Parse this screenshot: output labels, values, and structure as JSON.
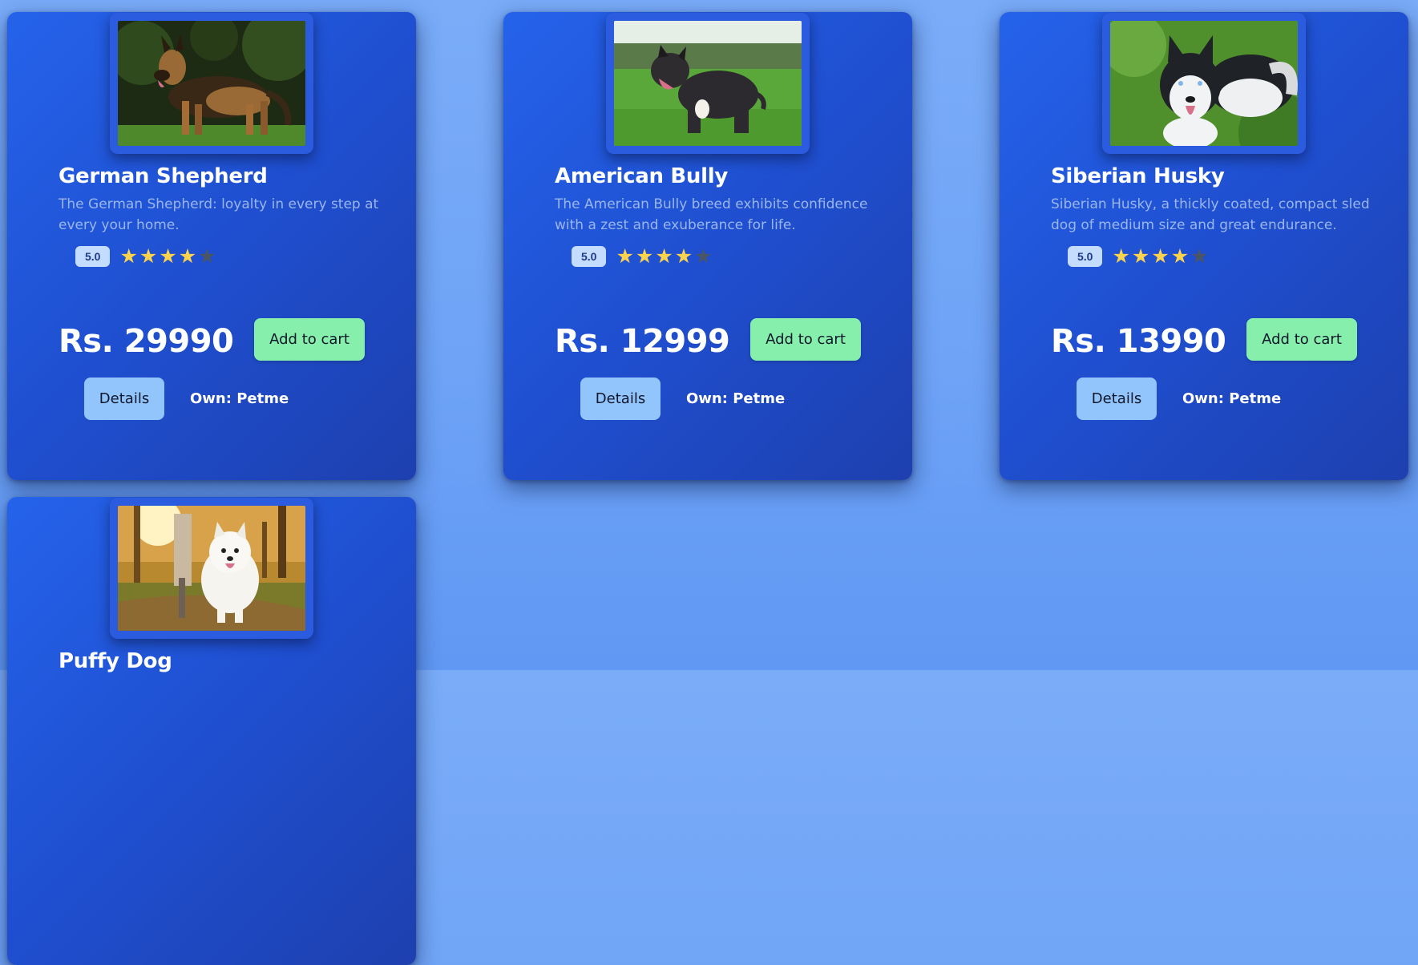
{
  "products": [
    {
      "name": "German Shepherd",
      "description": "The German Shepherd: loyalty in every step at every your home.",
      "rating": "5.0",
      "stars_filled": 4,
      "stars_total": 5,
      "price": "Rs. 29990",
      "cart_label": "Add to cart",
      "details_label": "Details",
      "owner": "Own: Petme",
      "image_icon": "german-shepherd-photo"
    },
    {
      "name": "American Bully",
      "description": "The American Bully breed exhibits confidence with a zest and exuberance for life.",
      "rating": "5.0",
      "stars_filled": 4,
      "stars_total": 5,
      "price": "Rs. 12999",
      "cart_label": "Add to cart",
      "details_label": "Details",
      "owner": "Own: Petme",
      "image_icon": "american-bully-photo"
    },
    {
      "name": "Siberian Husky",
      "description": "Siberian Husky, a thickly coated, compact sled dog of medium size and great endurance.",
      "rating": "5.0",
      "stars_filled": 4,
      "stars_total": 5,
      "price": "Rs. 13990",
      "cart_label": "Add to cart",
      "details_label": "Details",
      "owner": "Own: Petme",
      "image_icon": "siberian-husky-photo"
    },
    {
      "name": "Puffy Dog",
      "image_icon": "puffy-dog-photo"
    }
  ],
  "colors": {
    "page_background": "#6ea3f6",
    "card_background": "#2563eb",
    "cart_button": "#86efac",
    "details_button": "#93c5fd",
    "star_on": "#fcd34d",
    "star_off": "#4b5563",
    "rating_badge": "#c4dcff"
  }
}
